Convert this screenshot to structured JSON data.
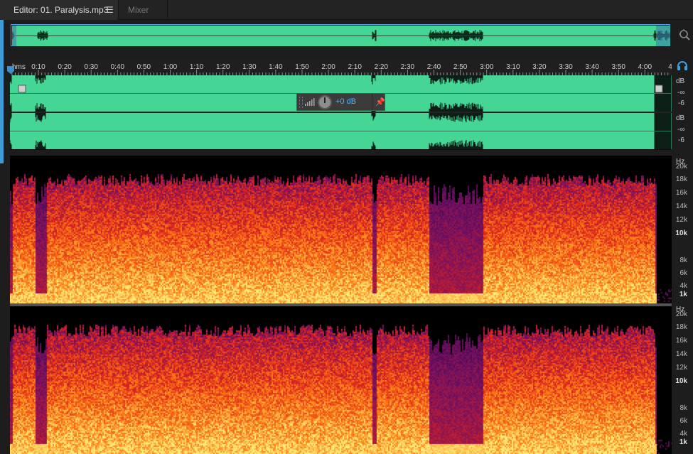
{
  "tabs": {
    "editor_label": "Editor: 01. Paralysis.mp3",
    "menu_glyph": "☰",
    "mixer_label": "Mixer"
  },
  "ruler": {
    "unit": "hms",
    "ticks": [
      "0:10",
      "0:20",
      "0:30",
      "0:40",
      "0:50",
      "1:00",
      "1:10",
      "1:20",
      "1:30",
      "1:40",
      "1:50",
      "2:00",
      "2:10",
      "2:20",
      "2:30",
      "2:40",
      "2:50",
      "3:00",
      "3:10",
      "3:20",
      "3:30",
      "3:40",
      "3:50",
      "4:00",
      "4:"
    ]
  },
  "amplitude_scale": {
    "channels": [
      {
        "unit": "dB",
        "labels": [
          "-∞",
          "-6"
        ]
      },
      {
        "unit": "dB",
        "labels": [
          "-∞",
          "-6"
        ]
      }
    ]
  },
  "frequency_scale": {
    "channels": [
      {
        "unit": "Hz",
        "labels": [
          "20k",
          "18k",
          "16k",
          "14k",
          "12k",
          "10k",
          "8k",
          "6k",
          "4k",
          "1k"
        ]
      },
      {
        "unit": "Hz",
        "labels": [
          "20k",
          "18k",
          "16k",
          "14k",
          "12k",
          "10k",
          "8k",
          "6k",
          "4k",
          "1k"
        ]
      }
    ]
  },
  "hud": {
    "value": "+0 dB",
    "pin_glyph": "📌"
  },
  "icons": {
    "zoom": "zoom-icon",
    "headphones": "headphones-icon",
    "playhead": "playhead-icon",
    "fade_in": "fade-in-handle-icon",
    "fade_out": "fade-out-handle-icon"
  },
  "colors": {
    "waveform": "#45d695",
    "waveform_dark": "#0c1f16",
    "accent": "#3d9bd7",
    "spectrum_low": "#1a0b2e",
    "spectrum_mid": "#c42b19",
    "spectrum_high": "#ffd66b"
  }
}
